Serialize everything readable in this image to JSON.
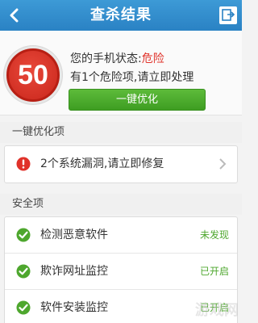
{
  "header": {
    "title": "查杀结果"
  },
  "summary": {
    "score": "50",
    "status_prefix": "您的手机状态:",
    "status_value": "危险",
    "risk_text": "有1个危险项,请立即处理",
    "optimize_button": "一键优化"
  },
  "optimize_section": {
    "title": "一键优化项",
    "items": [
      {
        "label": "2个系统漏洞,请立即修复",
        "icon": "warning-icon"
      }
    ]
  },
  "security_section": {
    "title": "安全项",
    "items": [
      {
        "label": "检测恶意软件",
        "status": "未发现",
        "icon": "check-icon"
      },
      {
        "label": "欺诈网址监控",
        "status": "已开启",
        "icon": "check-icon"
      },
      {
        "label": "软件安装监控",
        "status": "已开启",
        "icon": "check-icon"
      }
    ]
  },
  "watermark_text": "游戏网",
  "colors": {
    "topbar": "#2a82c4",
    "danger": "#e0322a",
    "success": "#4ea72e",
    "button": "#45a526"
  }
}
